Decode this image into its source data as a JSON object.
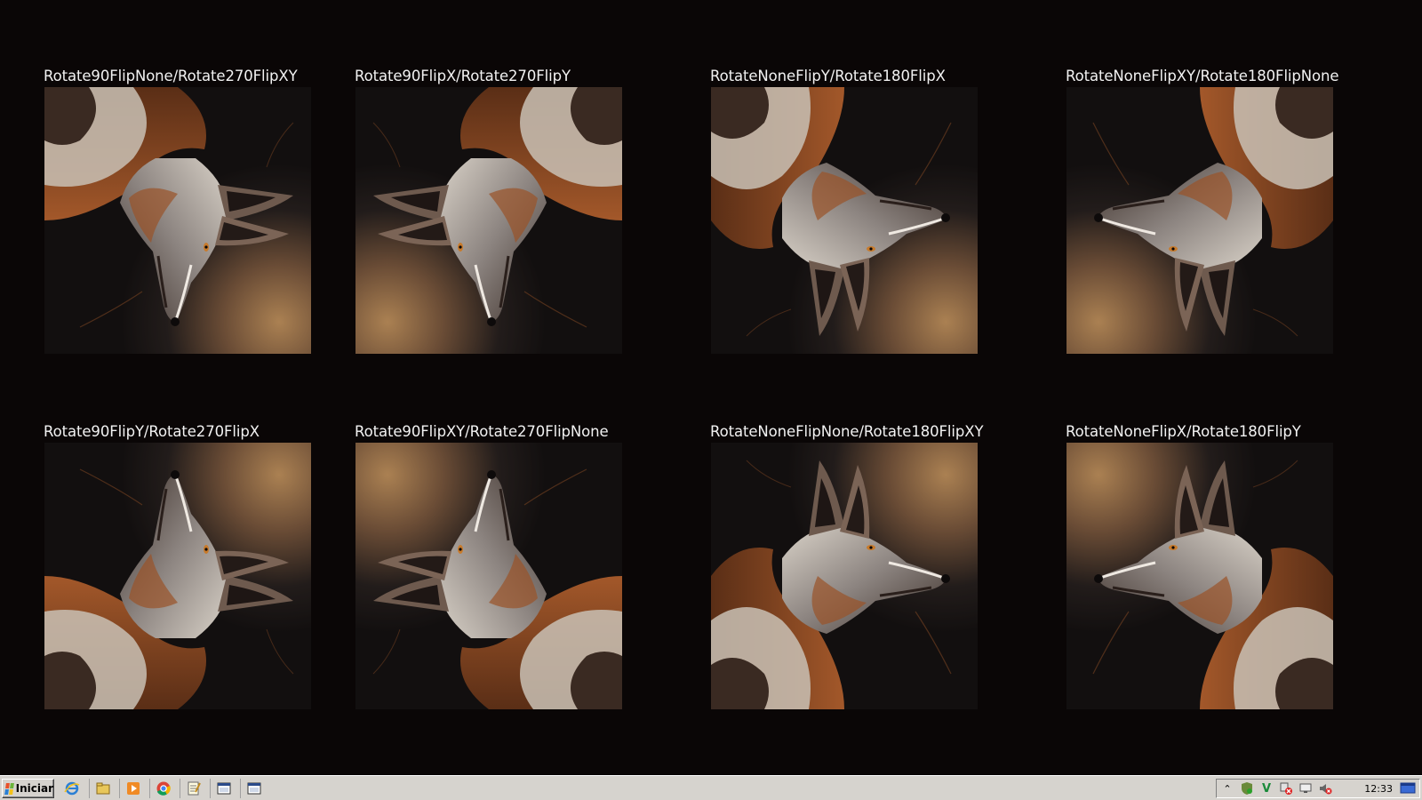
{
  "captions": [
    "Rotate90FlipNone/Rotate270FlipXY",
    "Rotate90FlipX/Rotate270FlipY",
    "RotateNoneFlipY/Rotate180FlipX",
    "RotateNoneFlipXY/Rotate180FlipNone",
    "Rotate90FlipY/Rotate270FlipX",
    "Rotate90FlipXY/Rotate270FlipNone",
    "RotateNoneFlipNone/Rotate180FlipXY",
    "RotateNoneFlipX/Rotate180FlipY"
  ],
  "taskbar": {
    "start_label": "Iniciar",
    "clock": "12:33",
    "quick_launch_icons": [
      "internet-explorer-icon",
      "folder-icon",
      "media-player-icon",
      "chrome-icon",
      "notepad-icon",
      "window-icon",
      "window-icon"
    ],
    "tray_icons": [
      "arrow-up-icon",
      "shield-icon",
      "v-icon",
      "network-error-icon",
      "monitor-icon",
      "volume-muted-icon"
    ]
  },
  "colors": {
    "background": "#0a0606",
    "caption_text": "#f2f2f2",
    "taskbar": "#d6d3ce"
  }
}
